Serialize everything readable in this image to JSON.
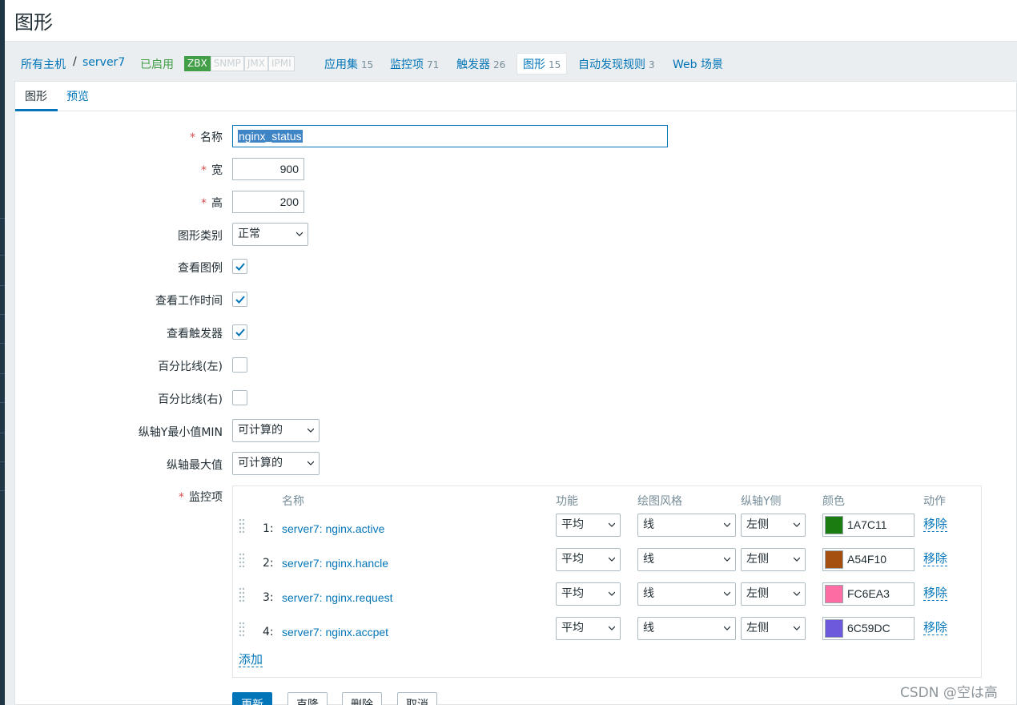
{
  "page": {
    "title": "图形"
  },
  "host_nav": {
    "all_hosts": "所有主机",
    "separator": "/",
    "host": "server7",
    "status": "已启用",
    "badges": [
      "ZBX",
      "SNMP",
      "JMX",
      "IPMI"
    ],
    "applications": {
      "label": "应用集",
      "count": "15"
    },
    "items": {
      "label": "监控项",
      "count": "71"
    },
    "triggers": {
      "label": "触发器",
      "count": "26"
    },
    "graphs": {
      "label": "图形",
      "count": "15"
    },
    "discovery": {
      "label": "自动发现规则",
      "count": "3"
    },
    "web": {
      "label": "Web 场景"
    }
  },
  "tabs": {
    "graph": "图形",
    "preview": "预览"
  },
  "form": {
    "name": {
      "label": "名称",
      "value": "nginx_status"
    },
    "width": {
      "label": "宽",
      "value": "900"
    },
    "height": {
      "label": "高",
      "value": "200"
    },
    "graph_type": {
      "label": "图形类别",
      "value": "正常"
    },
    "show_legend": {
      "label": "查看图例",
      "checked": true
    },
    "show_working_time": {
      "label": "查看工作时间",
      "checked": true
    },
    "show_triggers": {
      "label": "查看触发器",
      "checked": true
    },
    "percentile_left": {
      "label": "百分比线(左)",
      "checked": false
    },
    "percentile_right": {
      "label": "百分比线(右)",
      "checked": false
    },
    "ymin": {
      "label": "纵轴Y最小值MIN",
      "value": "可计算的"
    },
    "ymax": {
      "label": "纵轴最大值",
      "value": "可计算的"
    },
    "items_label": "监控项"
  },
  "items_table": {
    "headers": {
      "name": "名称",
      "function": "功能",
      "draw_style": "绘图风格",
      "y_axis_side": "纵轴Y侧",
      "color": "颜色",
      "action": "动作"
    },
    "rows": [
      {
        "index": "1:",
        "name": "server7: nginx.active",
        "function": "平均",
        "draw_style": "线",
        "y_axis_side": "左侧",
        "color": "1A7C11",
        "action": "移除"
      },
      {
        "index": "2:",
        "name": "server7: nginx.hancle",
        "function": "平均",
        "draw_style": "线",
        "y_axis_side": "左侧",
        "color": "A54F10",
        "action": "移除"
      },
      {
        "index": "3:",
        "name": "server7: nginx.request",
        "function": "平均",
        "draw_style": "线",
        "y_axis_side": "左侧",
        "color": "FC6EA3",
        "action": "移除"
      },
      {
        "index": "4:",
        "name": "server7: nginx.accpet",
        "function": "平均",
        "draw_style": "线",
        "y_axis_side": "左侧",
        "color": "6C59DC",
        "action": "移除"
      }
    ],
    "add": "添加"
  },
  "buttons": {
    "update": "更新",
    "clone": "克隆",
    "delete": "删除",
    "cancel": "取消"
  },
  "watermark": "CSDN @空は高",
  "colors": {
    "accent": "#0275b8",
    "enabled": "#429e47",
    "required": "#d64e4e"
  }
}
